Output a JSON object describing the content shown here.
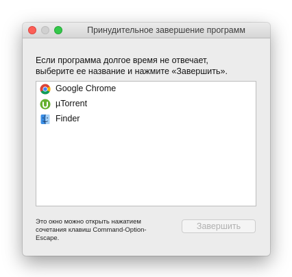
{
  "window": {
    "title": "Принудительное завершение программ"
  },
  "prompt": {
    "line1": "Если программа долгое время не отвечает,",
    "line2": "выберите ее название и нажмите «Завершить»."
  },
  "apps": [
    {
      "name": "Google Chrome",
      "icon": "chrome-icon"
    },
    {
      "name": "µTorrent",
      "icon": "utorrent-icon"
    },
    {
      "name": "Finder",
      "icon": "finder-icon"
    }
  ],
  "hint": {
    "line1": "Это окно можно открыть нажатием",
    "line2": "сочетания клавиш Command-Option-",
    "line3": "Escape."
  },
  "buttons": {
    "quit_label": "Завершить"
  },
  "colors": {
    "close": "#fc5f57",
    "minimize_inactive": "#d0d0d0",
    "zoom": "#34c84a",
    "utorrent_green": "#66b02f",
    "finder_blue": "#3a8ee6"
  }
}
